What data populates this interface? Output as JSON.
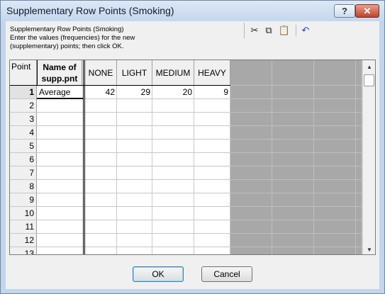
{
  "window": {
    "title": "Supplementary Row Points (Smoking)",
    "help_label": "?",
    "close_label": "✕"
  },
  "description": {
    "line1": "Supplementary Row Points (Smoking)",
    "line2": "Enter the values (frequencies) for the new",
    "line3": "(supplementary) points; then click OK."
  },
  "toolbar": {
    "cut_icon": "✂",
    "copy_icon": "⧉",
    "paste_icon": "📋",
    "undo_icon": "↶"
  },
  "grid": {
    "corner_label": "Point",
    "name_header_line1": "Name of",
    "name_header_line2": "supp.pnt",
    "columns": [
      "NONE",
      "LIGHT",
      "MEDIUM",
      "HEAVY"
    ],
    "rows": [
      {
        "num": "1",
        "name": "Average",
        "values": [
          "42",
          "29",
          "20",
          "9"
        ]
      },
      {
        "num": "2",
        "name": "",
        "values": [
          "",
          "",
          "",
          ""
        ]
      },
      {
        "num": "3",
        "name": "",
        "values": [
          "",
          "",
          "",
          ""
        ]
      },
      {
        "num": "4",
        "name": "",
        "values": [
          "",
          "",
          "",
          ""
        ]
      },
      {
        "num": "5",
        "name": "",
        "values": [
          "",
          "",
          "",
          ""
        ]
      },
      {
        "num": "6",
        "name": "",
        "values": [
          "",
          "",
          "",
          ""
        ]
      },
      {
        "num": "7",
        "name": "",
        "values": [
          "",
          "",
          "",
          ""
        ]
      },
      {
        "num": "8",
        "name": "",
        "values": [
          "",
          "",
          "",
          ""
        ]
      },
      {
        "num": "9",
        "name": "",
        "values": [
          "",
          "",
          "",
          ""
        ]
      },
      {
        "num": "10",
        "name": "",
        "values": [
          "",
          "",
          "",
          ""
        ]
      },
      {
        "num": "11",
        "name": "",
        "values": [
          "",
          "",
          "",
          ""
        ]
      },
      {
        "num": "12",
        "name": "",
        "values": [
          "",
          "",
          "",
          ""
        ]
      },
      {
        "num": "13",
        "name": "",
        "values": [
          "",
          "",
          "",
          ""
        ]
      }
    ]
  },
  "buttons": {
    "ok_label": "OK",
    "cancel_label": "Cancel"
  },
  "colors": {
    "title_bar": "#c4d7ed",
    "close_button": "#c0422b",
    "unused_columns": "#a8a8a8"
  }
}
